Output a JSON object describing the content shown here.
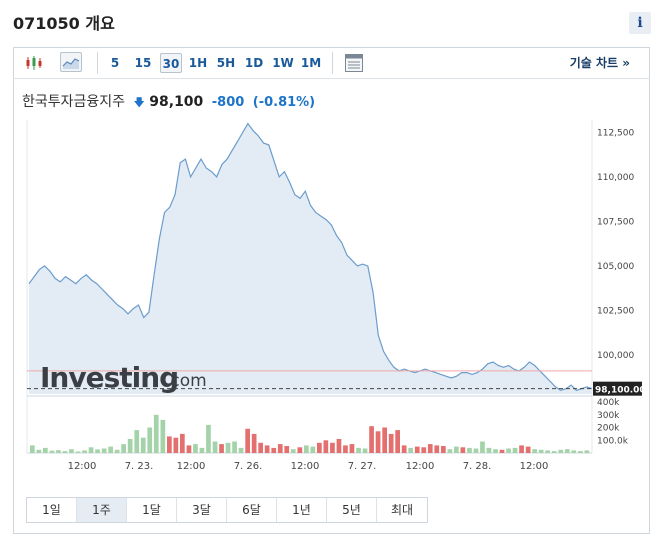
{
  "header": {
    "title": "071050 개요",
    "info_label": "i"
  },
  "toolbar": {
    "intervals": [
      "5",
      "15",
      "30",
      "1H",
      "5H",
      "1D",
      "1W",
      "1M"
    ],
    "selected_interval": "30",
    "tech_chart_label": "기술 차트 »"
  },
  "quote": {
    "name": "한국투자금융지주",
    "arrow": "🡇",
    "price": "98,100",
    "change": "-800",
    "change_pct": "(-0.81%)"
  },
  "range_buttons": [
    "1일",
    "1주",
    "1달",
    "3달",
    "6달",
    "1년",
    "5년",
    "최대"
  ],
  "selected_range": "1주",
  "watermark": {
    "brand": "Investing",
    "suffix": ".com"
  },
  "colors": {
    "line": "#6a9ccc",
    "fill": "#e3ecf5",
    "up": "#a4d3a9",
    "down": "#e46f6f",
    "accent": "#1e74c8"
  },
  "chart_data": {
    "type": "area",
    "title": "",
    "x_tick_labels": [
      "12:00",
      "7. 23.",
      "12:00",
      "7. 26.",
      "12:00",
      "7. 27.",
      "12:00",
      "7. 28.",
      "12:00"
    ],
    "y_tick_labels": [
      "112,500",
      "110,000",
      "107,500",
      "105,000",
      "102,500",
      "100,000"
    ],
    "ylim": [
      97800,
      113200
    ],
    "last_price_label": "98,100.00",
    "last_price": 98100,
    "reference_line": 99100,
    "price": [
      104000,
      104400,
      104800,
      105000,
      104700,
      104300,
      104100,
      104400,
      104200,
      104000,
      104300,
      104500,
      104200,
      104000,
      103700,
      103400,
      103100,
      102800,
      102600,
      102300,
      102600,
      102800,
      102100,
      102400,
      104500,
      106500,
      108000,
      108300,
      109000,
      110800,
      111000,
      110000,
      110500,
      111000,
      110500,
      110300,
      110000,
      110700,
      111000,
      111500,
      112000,
      112500,
      113000,
      112600,
      112300,
      111900,
      111800,
      110900,
      110000,
      110300,
      109700,
      109000,
      108800,
      109200,
      108400,
      108000,
      107800,
      107600,
      107300,
      106700,
      106300,
      105600,
      105300,
      105000,
      105100,
      105000,
      103500,
      101100,
      100200,
      99700,
      99300,
      99100,
      99200,
      99100,
      99000,
      99100,
      99200,
      99100,
      99000,
      98900,
      98800,
      98700,
      98800,
      99000,
      99000,
      98900,
      99000,
      99200,
      99500,
      99600,
      99400,
      99300,
      99400,
      99200,
      99100,
      99300,
      99600,
      99400,
      99100,
      98800,
      98500,
      98200,
      98000,
      98100,
      98300,
      98000,
      98100,
      98200,
      98100
    ],
    "volume_y_tick_labels": [
      "400k",
      "300k",
      "200k",
      "100.0k"
    ],
    "volume_ylim": [
      0,
      400000
    ],
    "volume": [
      {
        "v": 60000,
        "c": "up"
      },
      {
        "v": 25000,
        "c": "up"
      },
      {
        "v": 40000,
        "c": "up"
      },
      {
        "v": 18000,
        "c": "up"
      },
      {
        "v": 22000,
        "c": "up"
      },
      {
        "v": 15000,
        "c": "up"
      },
      {
        "v": 30000,
        "c": "up"
      },
      {
        "v": 12000,
        "c": "up"
      },
      {
        "v": 20000,
        "c": "up"
      },
      {
        "v": 45000,
        "c": "up"
      },
      {
        "v": 28000,
        "c": "up"
      },
      {
        "v": 35000,
        "c": "up"
      },
      {
        "v": 50000,
        "c": "up"
      },
      {
        "v": 25000,
        "c": "up"
      },
      {
        "v": 70000,
        "c": "up"
      },
      {
        "v": 110000,
        "c": "up"
      },
      {
        "v": 180000,
        "c": "up"
      },
      {
        "v": 120000,
        "c": "up"
      },
      {
        "v": 200000,
        "c": "up"
      },
      {
        "v": 300000,
        "c": "up"
      },
      {
        "v": 260000,
        "c": "up"
      },
      {
        "v": 130000,
        "c": "down"
      },
      {
        "v": 120000,
        "c": "down"
      },
      {
        "v": 150000,
        "c": "down"
      },
      {
        "v": 60000,
        "c": "down"
      },
      {
        "v": 70000,
        "c": "up"
      },
      {
        "v": 40000,
        "c": "up"
      },
      {
        "v": 220000,
        "c": "up"
      },
      {
        "v": 90000,
        "c": "up"
      },
      {
        "v": 70000,
        "c": "down"
      },
      {
        "v": 80000,
        "c": "up"
      },
      {
        "v": 90000,
        "c": "up"
      },
      {
        "v": 40000,
        "c": "up"
      },
      {
        "v": 190000,
        "c": "down"
      },
      {
        "v": 150000,
        "c": "down"
      },
      {
        "v": 80000,
        "c": "down"
      },
      {
        "v": 60000,
        "c": "down"
      },
      {
        "v": 40000,
        "c": "down"
      },
      {
        "v": 70000,
        "c": "down"
      },
      {
        "v": 55000,
        "c": "down"
      },
      {
        "v": 30000,
        "c": "up"
      },
      {
        "v": 45000,
        "c": "down"
      },
      {
        "v": 60000,
        "c": "up"
      },
      {
        "v": 50000,
        "c": "up"
      },
      {
        "v": 80000,
        "c": "down"
      },
      {
        "v": 100000,
        "c": "down"
      },
      {
        "v": 80000,
        "c": "down"
      },
      {
        "v": 110000,
        "c": "down"
      },
      {
        "v": 60000,
        "c": "down"
      },
      {
        "v": 70000,
        "c": "down"
      },
      {
        "v": 40000,
        "c": "up"
      },
      {
        "v": 35000,
        "c": "up"
      },
      {
        "v": 210000,
        "c": "down"
      },
      {
        "v": 170000,
        "c": "down"
      },
      {
        "v": 200000,
        "c": "down"
      },
      {
        "v": 150000,
        "c": "down"
      },
      {
        "v": 180000,
        "c": "down"
      },
      {
        "v": 60000,
        "c": "down"
      },
      {
        "v": 40000,
        "c": "up"
      },
      {
        "v": 50000,
        "c": "down"
      },
      {
        "v": 45000,
        "c": "down"
      },
      {
        "v": 70000,
        "c": "down"
      },
      {
        "v": 60000,
        "c": "down"
      },
      {
        "v": 55000,
        "c": "down"
      },
      {
        "v": 30000,
        "c": "up"
      },
      {
        "v": 50000,
        "c": "up"
      },
      {
        "v": 45000,
        "c": "down"
      },
      {
        "v": 40000,
        "c": "up"
      },
      {
        "v": 35000,
        "c": "up"
      },
      {
        "v": 90000,
        "c": "up"
      },
      {
        "v": 40000,
        "c": "up"
      },
      {
        "v": 30000,
        "c": "up"
      },
      {
        "v": 25000,
        "c": "down"
      },
      {
        "v": 35000,
        "c": "up"
      },
      {
        "v": 40000,
        "c": "up"
      },
      {
        "v": 60000,
        "c": "down"
      },
      {
        "v": 50000,
        "c": "down"
      },
      {
        "v": 30000,
        "c": "up"
      },
      {
        "v": 25000,
        "c": "up"
      },
      {
        "v": 20000,
        "c": "up"
      },
      {
        "v": 15000,
        "c": "up"
      },
      {
        "v": 25000,
        "c": "up"
      },
      {
        "v": 30000,
        "c": "up"
      },
      {
        "v": 20000,
        "c": "up"
      },
      {
        "v": 15000,
        "c": "up"
      },
      {
        "v": 20000,
        "c": "up"
      }
    ]
  }
}
